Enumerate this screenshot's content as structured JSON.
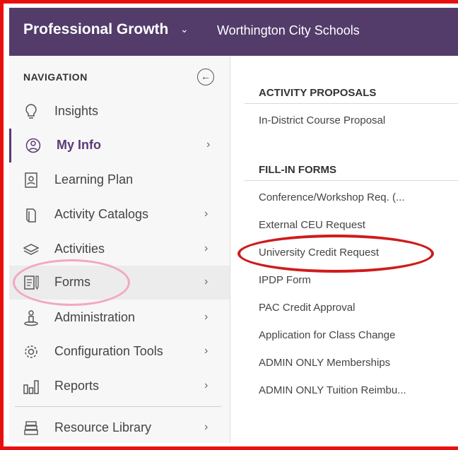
{
  "header": {
    "app_title": "Professional Growth",
    "caret": "⌄",
    "org_name": "Worthington City Schools"
  },
  "sidebar": {
    "heading": "NAVIGATION",
    "collapse_icon": "←",
    "items": [
      {
        "label": "Insights",
        "icon": "lightbulb-icon",
        "has_chevron": false
      },
      {
        "label": "My Info",
        "icon": "user-circle-icon",
        "has_chevron": true,
        "active": true
      },
      {
        "label": "Learning Plan",
        "icon": "address-book-icon",
        "has_chevron": false
      },
      {
        "label": "Activity Catalogs",
        "icon": "book-icon",
        "has_chevron": true
      },
      {
        "label": "Activities",
        "icon": "layers-icon",
        "has_chevron": true
      },
      {
        "label": "Forms",
        "icon": "form-icon",
        "has_chevron": true,
        "hover": true
      },
      {
        "label": "Administration",
        "icon": "admin-icon",
        "has_chevron": true
      },
      {
        "label": "Configuration Tools",
        "icon": "gear-icon",
        "has_chevron": true
      },
      {
        "label": "Reports",
        "icon": "bar-chart-icon",
        "has_chevron": true
      },
      {
        "label": "Resource Library",
        "icon": "library-icon",
        "has_chevron": true
      }
    ],
    "chevron": "›"
  },
  "content": {
    "sections": [
      {
        "title": "ACTIVITY PROPOSALS",
        "links": [
          "In-District Course Proposal"
        ]
      },
      {
        "title": "FILL-IN FORMS",
        "links": [
          "Conference/Workshop Req. (...",
          "External CEU Request",
          "University Credit Request",
          "IPDP Form",
          "PAC Credit Approval",
          "Application for Class Change",
          "ADMIN ONLY Memberships",
          "ADMIN ONLY Tuition Reimbu..."
        ]
      }
    ]
  },
  "annotations": {
    "frame_color": "#e8100f",
    "ellipse_red": "#d01b1b",
    "ellipse_pink": "#f2a7c6"
  },
  "colors": {
    "header_bg": "#533c6a",
    "active_accent": "#5a3a78"
  }
}
